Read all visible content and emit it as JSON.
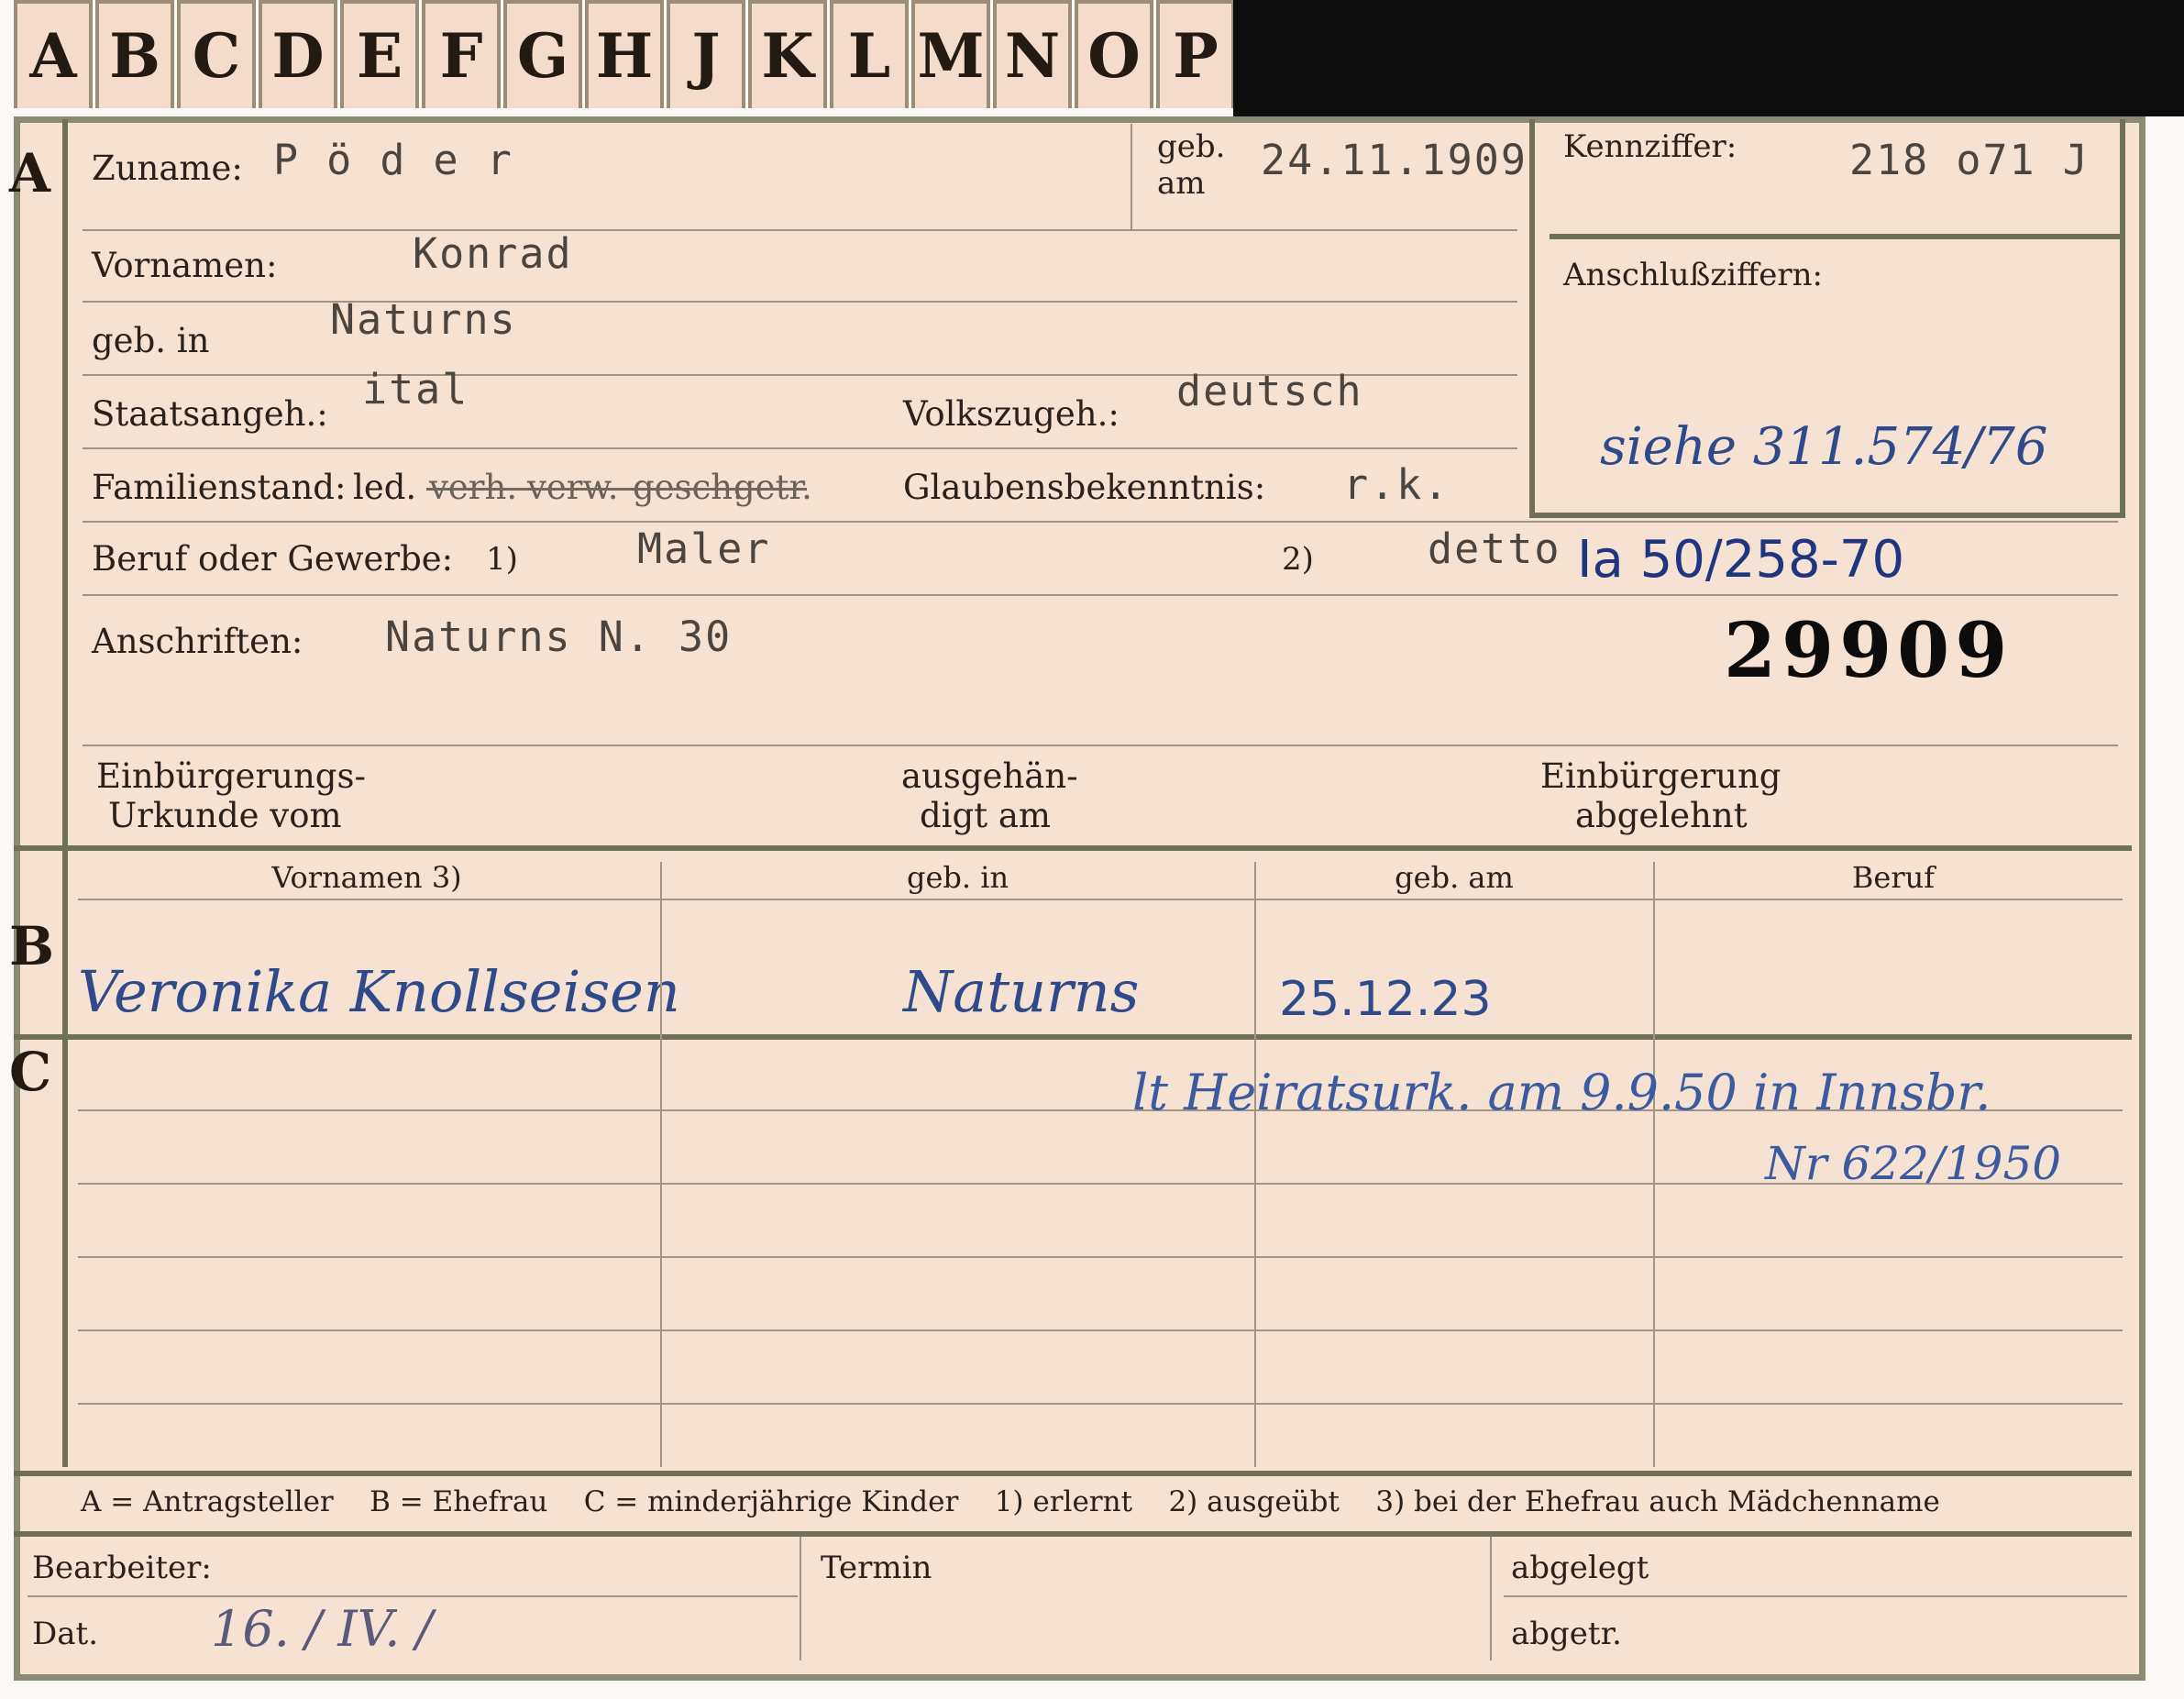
{
  "tabs": [
    "A",
    "B",
    "C",
    "D",
    "E",
    "F",
    "G",
    "H",
    "J",
    "K",
    "L",
    "M",
    "N",
    "O",
    "P"
  ],
  "section_letters": {
    "a": "A",
    "b": "B",
    "c": "C"
  },
  "applicant": {
    "surname_label": "Zuname:",
    "surname": "P ö d e r",
    "born_on_label_1": "geb.",
    "born_on_label_2": "am",
    "born_on": "24.11.1909",
    "first_names_label": "Vornamen:",
    "first_names": "Konrad",
    "born_in_label": "geb. in",
    "born_in": "Naturns",
    "citizenship_label": "Staatsangeh.:",
    "citizenship": "ital",
    "ethnicity_label": "Volkszugeh.:",
    "ethnicity": "deutsch",
    "marital_label": "Familienstand:",
    "marital_options": [
      "led.",
      "verh.",
      "verw.",
      "gesch.",
      "getr."
    ],
    "religion_label": "Glaubensbekenntnis:",
    "religion": "r.k.",
    "occupation_label": "Beruf oder Gewerbe:",
    "occupation_note1": "1)",
    "occupation_learned": "Maler",
    "occupation_note2": "2)",
    "occupation_practiced": "detto",
    "address_label": "Anschriften:",
    "address": "Naturns N. 30",
    "naturalization_cert_label_1": "Einbürgerungs-",
    "naturalization_cert_label_2": "Urkunde vom",
    "handed_out_label_1": "ausgehän-",
    "handed_out_label_2": "digt am",
    "naturalization_denied_label_1": "Einbürgerung",
    "naturalization_denied_label_2": "abgelehnt"
  },
  "id_box": {
    "code_label": "Kennziffer:",
    "code": "218 o71 J",
    "linked_label": "Anschlußziffern:",
    "linked_note": "siehe 311.574/76"
  },
  "file_reference": "Ia 50/258-70",
  "stamp_number": "29909",
  "spouse_table": {
    "headers": [
      "Vornamen 3)",
      "geb. in",
      "geb. am",
      "Beruf"
    ],
    "first_names": "Veronika Knollseisen",
    "born_in": "Naturns",
    "born_on": "25.12.23"
  },
  "children_note": {
    "line1": "lt Heiratsurk. am 9.9.50 in Innsbr.",
    "line2": "Nr 622/1950"
  },
  "legend": "A = Antragsteller    B = Ehefrau    C = minderjährige Kinder    1) erlernt    2) ausgeübt    3) bei der Ehefrau auch Mädchenname",
  "footer": {
    "clerk_label": "Bearbeiter:",
    "date_label": "Dat.",
    "date_value": "16. / IV. /",
    "deadline_label": "Termin",
    "filed_label": "abgelegt",
    "transferred_label": "abgetr."
  }
}
